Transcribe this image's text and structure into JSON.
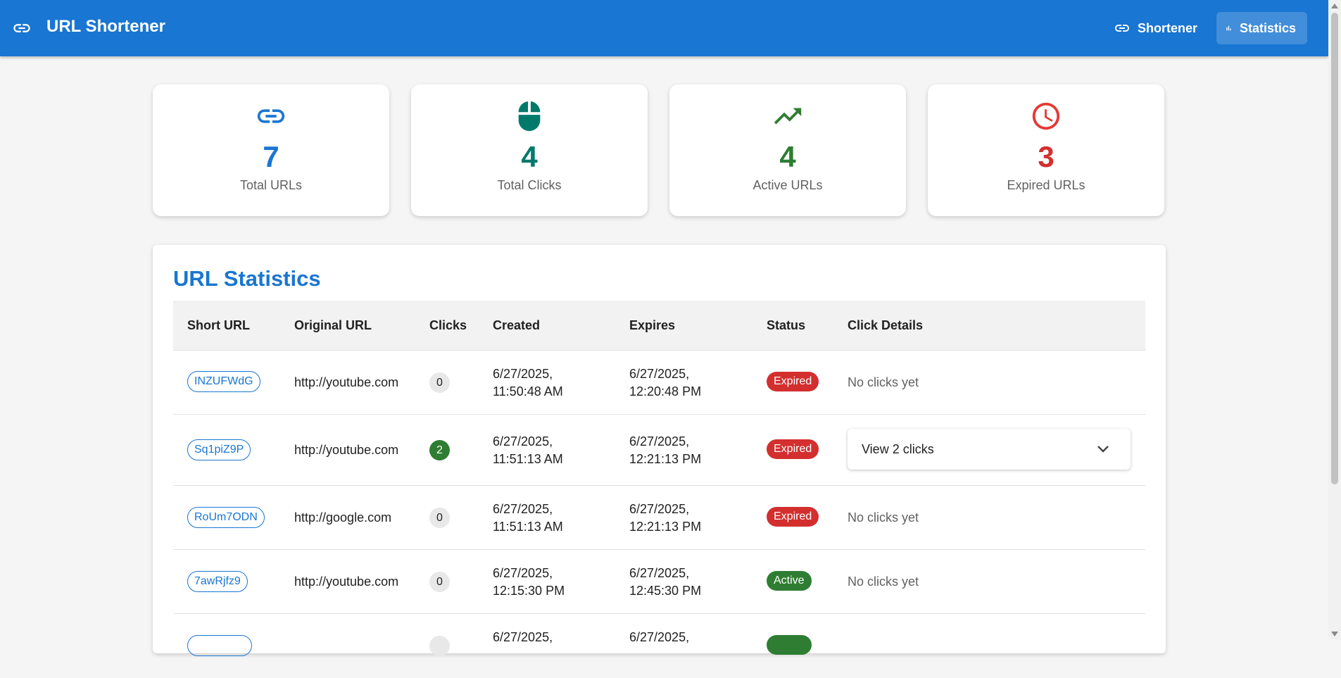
{
  "app": {
    "title": "URL Shortener",
    "nav": [
      {
        "label": "Shortener",
        "icon": "link-icon",
        "active": false
      },
      {
        "label": "Statistics",
        "icon": "bar-chart-icon",
        "active": true
      }
    ]
  },
  "stats": [
    {
      "value": "7",
      "label": "Total URLs",
      "icon": "link-icon",
      "color": "#1976d2"
    },
    {
      "value": "4",
      "label": "Total Clicks",
      "icon": "mouse-icon",
      "color": "#00796b"
    },
    {
      "value": "4",
      "label": "Active URLs",
      "icon": "trending-up-icon",
      "color": "#2e7d32"
    },
    {
      "value": "3",
      "label": "Expired URLs",
      "icon": "clock-icon",
      "color": "#d32f2f"
    }
  ],
  "table": {
    "title": "URL Statistics",
    "headers": [
      "Short URL",
      "Original URL",
      "Clicks",
      "Created",
      "Expires",
      "Status",
      "Click Details"
    ],
    "rows": [
      {
        "short": "INZUFWdG",
        "original": "http://youtube.com",
        "clicks": "0",
        "created": [
          "6/27/2025,",
          "11:50:48 AM"
        ],
        "expires": [
          "6/27/2025,",
          "12:20:48 PM"
        ],
        "status": "Expired",
        "details": "No clicks yet"
      },
      {
        "short": "Sq1piZ9P",
        "original": "http://youtube.com",
        "clicks": "2",
        "created": [
          "6/27/2025,",
          "11:51:13 AM"
        ],
        "expires": [
          "6/27/2025,",
          "12:21:13 PM"
        ],
        "status": "Expired",
        "details": "View 2 clicks"
      },
      {
        "short": "RoUm7ODN",
        "original": "http://google.com",
        "clicks": "0",
        "created": [
          "6/27/2025,",
          "11:51:13 AM"
        ],
        "expires": [
          "6/27/2025,",
          "12:21:13 PM"
        ],
        "status": "Expired",
        "details": "No clicks yet"
      },
      {
        "short": "7awRjfz9",
        "original": "http://youtube.com",
        "clicks": "0",
        "created": [
          "6/27/2025,",
          "12:15:30 PM"
        ],
        "expires": [
          "6/27/2025,",
          "12:45:30 PM"
        ],
        "status": "Active",
        "details": "No clicks yet"
      },
      {
        "short": "",
        "original": "",
        "clicks": "",
        "created": [
          "6/27/2025,",
          ""
        ],
        "expires": [
          "6/27/2025,",
          ""
        ],
        "status": "",
        "details": ""
      }
    ]
  }
}
